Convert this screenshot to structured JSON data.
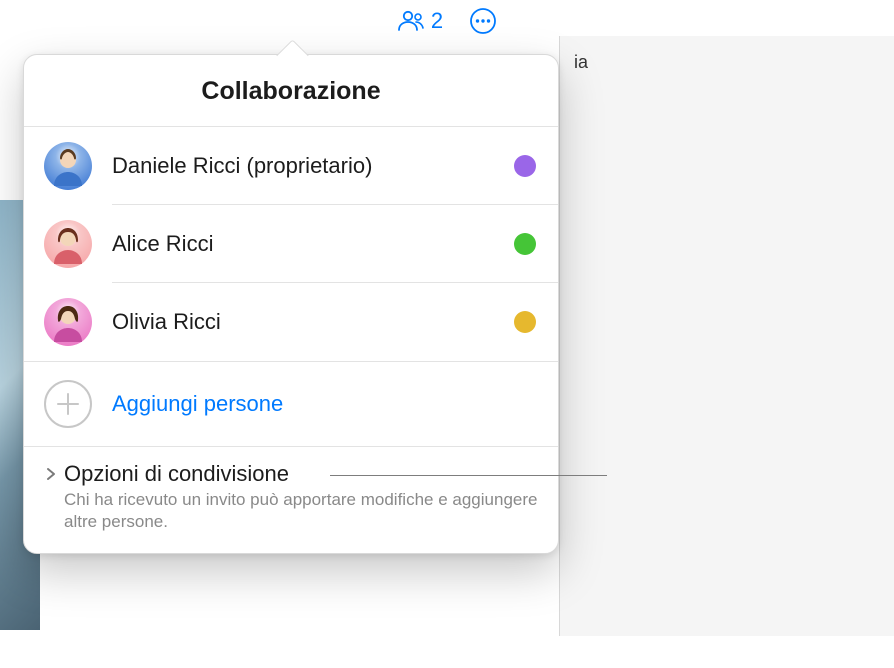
{
  "toolbar": {
    "participant_count": "2"
  },
  "popover": {
    "title": "Collaborazione",
    "participants": [
      {
        "name": "Daniele Ricci (proprietario)",
        "dot_color": "#9a66e8",
        "avatar_bg": "#2c6bcf"
      },
      {
        "name": "Alice Ricci",
        "dot_color": "#45c537",
        "avatar_bg": "#f59ea0"
      },
      {
        "name": "Olivia Ricci",
        "dot_color": "#e6b82e",
        "avatar_bg": "#e96bbf"
      }
    ],
    "add_label": "Aggiungi persone",
    "options_title": "Opzioni di condivisione",
    "options_desc": "Chi ha ricevuto un invito può apportare modifiche e aggiungere altre persone."
  },
  "bg_sidebar_text": "ia"
}
